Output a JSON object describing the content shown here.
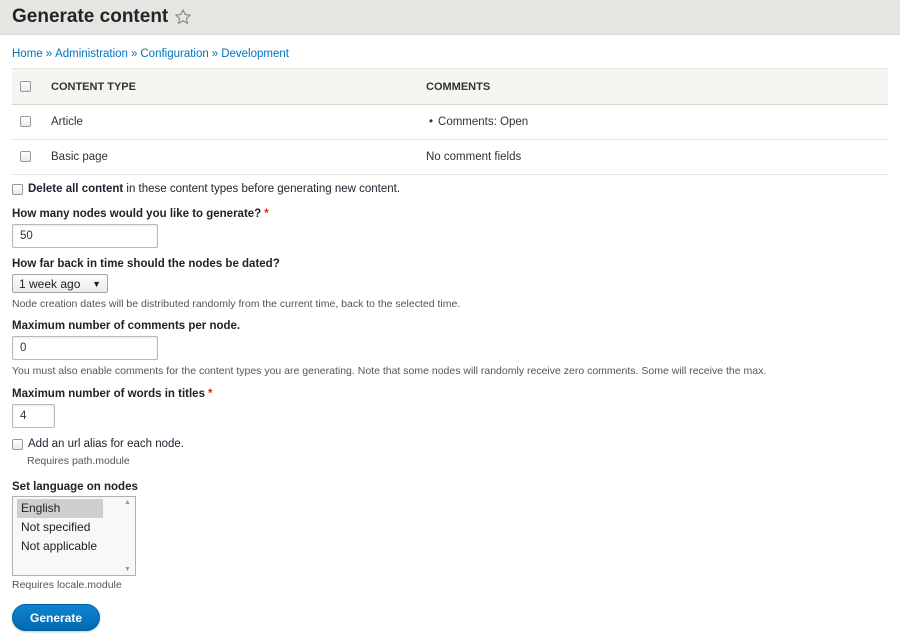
{
  "header": {
    "title": "Generate content",
    "star_icon": "star-outline-icon"
  },
  "breadcrumb": [
    "Home",
    "Administration",
    "Configuration",
    "Development"
  ],
  "breadcrumb_separator": "»",
  "table": {
    "headers": {
      "type": "CONTENT TYPE",
      "comments": "COMMENTS"
    },
    "rows": [
      {
        "type": "Article",
        "comments": "Comments: Open",
        "comments_bulleted": true
      },
      {
        "type": "Basic page",
        "comments": "No comment fields",
        "comments_bulleted": false
      }
    ]
  },
  "delete_all": {
    "bold": "Delete all content",
    "rest": " in these content types before generating new content."
  },
  "nodes": {
    "label": "How many nodes would you like to generate?",
    "required_mark": "*",
    "value": "50"
  },
  "time_range": {
    "label": "How far back in time should the nodes be dated?",
    "selected": "1 week ago",
    "description": "Node creation dates will be distributed randomly from the current time, back to the selected time."
  },
  "comments": {
    "label": "Maximum number of comments per node.",
    "value": "0",
    "description": "You must also enable comments for the content types you are generating. Note that some nodes will randomly receive zero comments. Some will receive the max."
  },
  "title_words": {
    "label": "Maximum number of words in titles",
    "required_mark": "*",
    "value": "4"
  },
  "url_alias": {
    "label": "Add an url alias for each node.",
    "description": "Requires path.module"
  },
  "language": {
    "label": "Set language on nodes",
    "options": [
      "English",
      "Not specified",
      "Not applicable"
    ],
    "selected": "English",
    "description": "Requires locale.module"
  },
  "submit": {
    "label": "Generate"
  },
  "colors": {
    "accent": "#0074bd",
    "required": "#e62600",
    "header_bg": "#e6e5e1"
  }
}
